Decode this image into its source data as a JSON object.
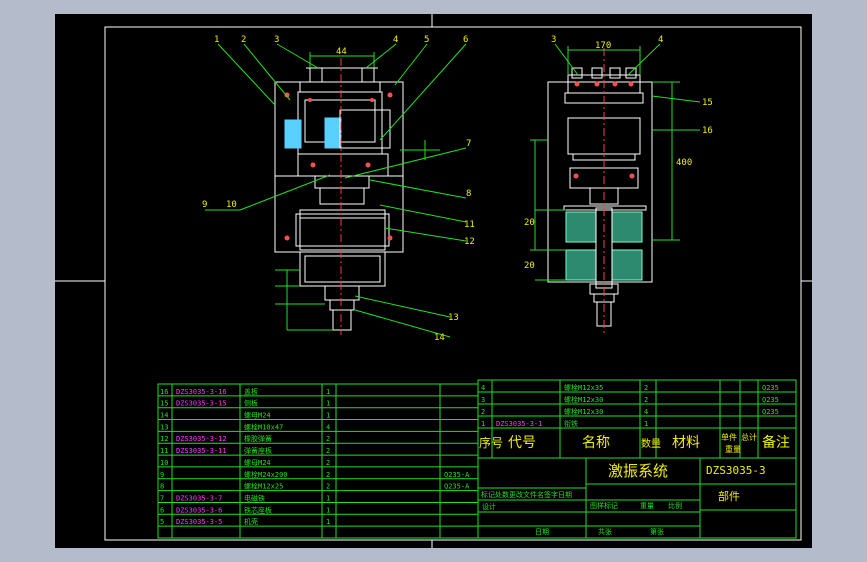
{
  "balloons_left": [
    "1",
    "2",
    "3",
    "4",
    "5",
    "6",
    "7",
    "8",
    "9",
    "10",
    "11",
    "12",
    "13",
    "14"
  ],
  "balloons_right": [
    "3",
    "4",
    "15",
    "16"
  ],
  "dims_left": {
    "top_width": "44"
  },
  "dims_right": {
    "top_width": "170",
    "side_height": "400",
    "small_a": "20",
    "small_b": "20"
  },
  "parts_list_left": [
    {
      "no": "16",
      "code": "DZS3035-3-16",
      "name": "盖板",
      "qty": "1",
      "mat": ""
    },
    {
      "no": "15",
      "code": "DZS3035-3-15",
      "name": "侧板",
      "qty": "1",
      "mat": ""
    },
    {
      "no": "14",
      "code": "",
      "name": "螺母M24",
      "qty": "1",
      "mat": ""
    },
    {
      "no": "13",
      "code": "",
      "name": "螺栓M10x47",
      "qty": "4",
      "mat": ""
    },
    {
      "no": "12",
      "code": "DZS3035-3-12",
      "name": "橡胶弹簧",
      "qty": "2",
      "mat": ""
    },
    {
      "no": "11",
      "code": "DZS3035-3-11",
      "name": "弹簧座板",
      "qty": "2",
      "mat": ""
    },
    {
      "no": "10",
      "code": "",
      "name": "螺母M24",
      "qty": "2",
      "mat": ""
    },
    {
      "no": "9",
      "code": "",
      "name": "螺栓M24x200",
      "qty": "2",
      "mat": "Q235-A"
    },
    {
      "no": "8",
      "code": "",
      "name": "螺栓M12x25",
      "qty": "2",
      "mat": "Q235-A"
    },
    {
      "no": "7",
      "code": "DZS3035-3-7",
      "name": "电磁铁",
      "qty": "1",
      "mat": ""
    },
    {
      "no": "6",
      "code": "DZS3035-3-6",
      "name": "铁芯座板",
      "qty": "1",
      "mat": ""
    },
    {
      "no": "5",
      "code": "DZS3035-3-5",
      "name": "机壳",
      "qty": "1",
      "mat": ""
    }
  ],
  "parts_list_right": [
    {
      "no": "4",
      "code": "",
      "name": "螺栓M12x35",
      "qty": "2",
      "mat": "",
      "note": "Q235"
    },
    {
      "no": "3",
      "code": "",
      "name": "螺栓M12x30",
      "qty": "2",
      "mat": "",
      "note": "Q235"
    },
    {
      "no": "2",
      "code": "",
      "name": "螺栓M12x30",
      "qty": "4",
      "mat": "",
      "note": "Q235"
    },
    {
      "no": "1",
      "code": "DZS3035-3-1",
      "name": "衔铁",
      "qty": "1",
      "mat": "",
      "note": ""
    }
  ],
  "header_labels": {
    "no": "序号",
    "code": "代号",
    "name": "名称",
    "qty": "数量",
    "mat": "材料",
    "unit": "单件",
    "total": "总计",
    "weight": "重量",
    "note": "备注"
  },
  "title_block": {
    "project": "激振系统",
    "drawing_no": "DZS3035-3",
    "sheet_kind": "部件",
    "design": "设计",
    "rev_row": "标记处数更改文件名签字日期",
    "stage_labels": [
      "图样标记",
      "重量",
      "比例"
    ],
    "date_label": "日期",
    "sheets_label": "共张",
    "sheet_label": "第张"
  }
}
